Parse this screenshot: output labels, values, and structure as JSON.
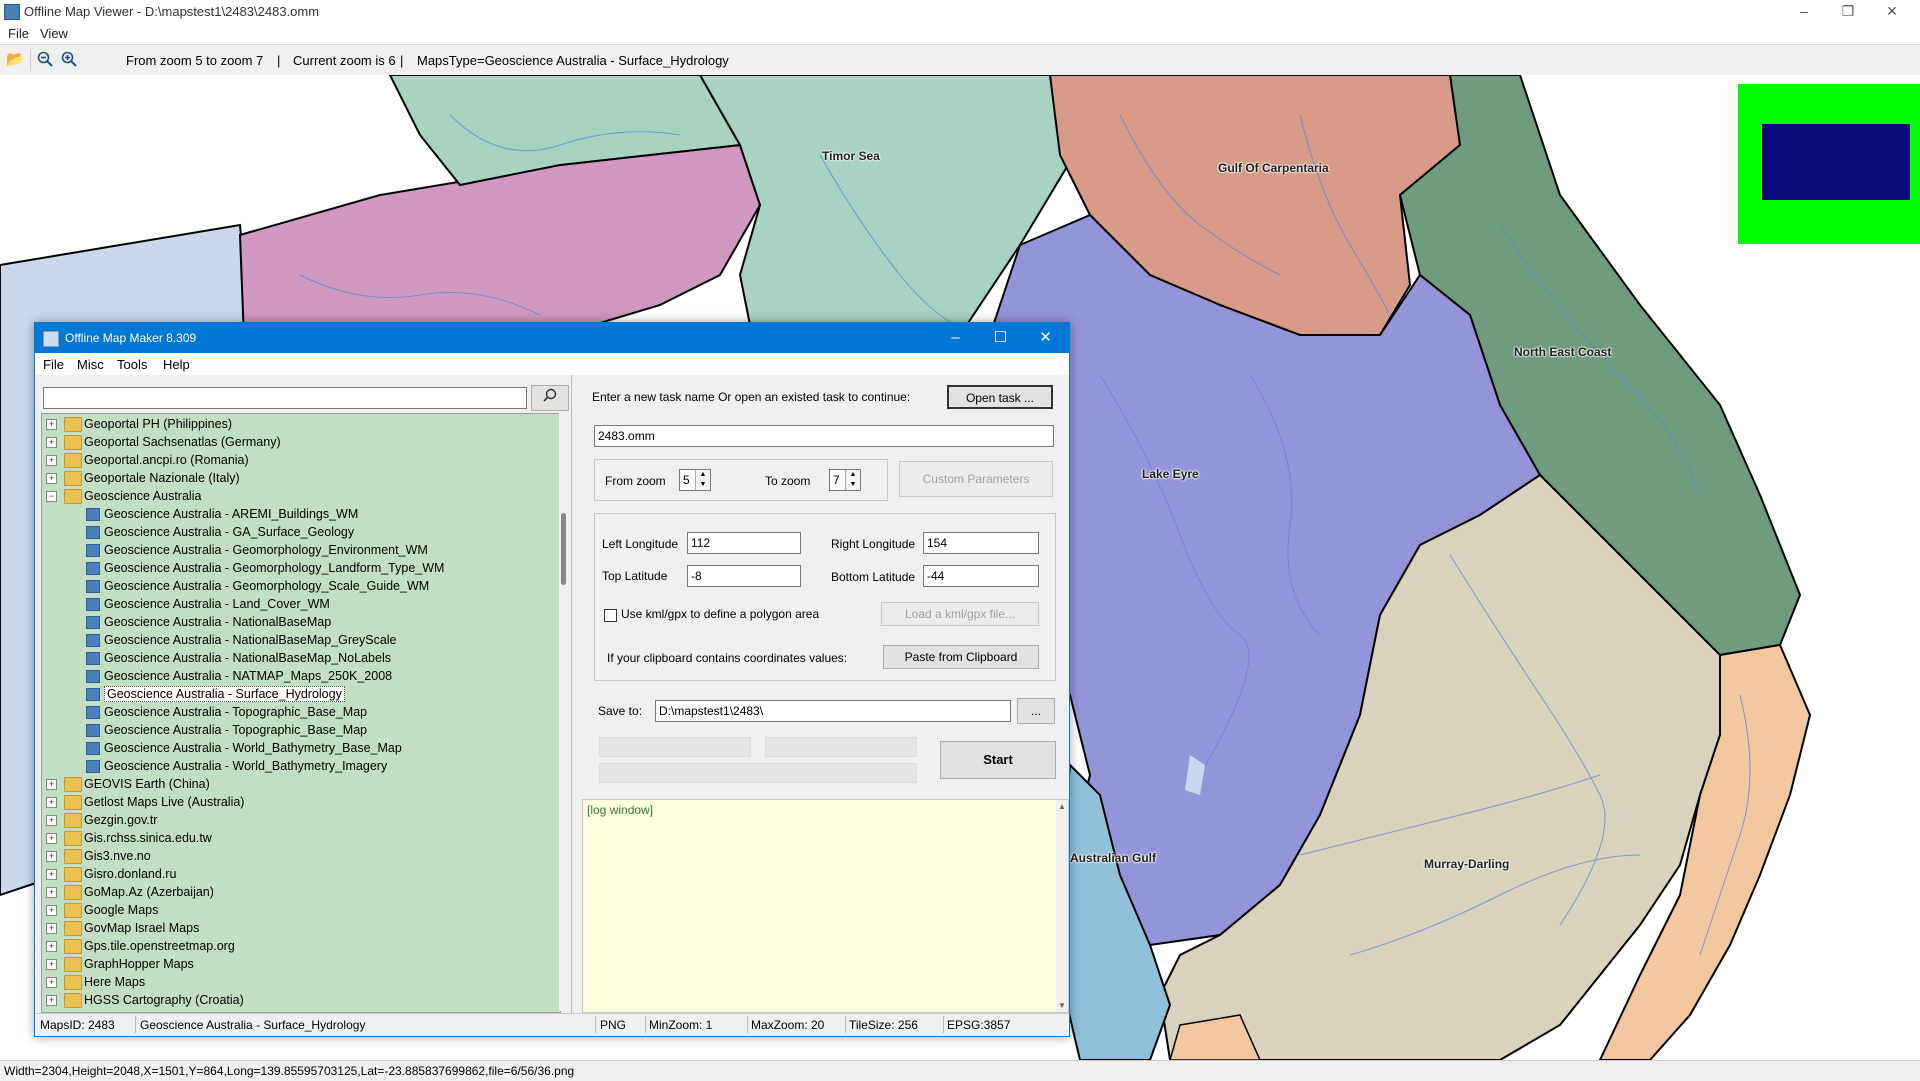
{
  "viewer": {
    "title": "Offline Map Viewer - D:\\mapstest1\\2483\\2483.omm",
    "menu": [
      "File",
      "View"
    ],
    "toolbar": {
      "zoom_range": "From zoom 5 to zoom 7",
      "separator1": "|",
      "current_zoom": "Current zoom is 6",
      "separator2": "|",
      "maps_type": "MapsType=Geoscience Australia - Surface_Hydrology"
    },
    "status": "Width=2304,Height=2048,X=1501,Y=864,Long=139.85595703125,Lat=-23.885837699862,file=6/56/36.png",
    "map_labels": {
      "timor_sea": "Timor Sea",
      "gulf_of_carpentaria": "Gulf Of Carpentaria",
      "north_east_coast": "North East Coast",
      "lake_eyre": "Lake Eyre",
      "australian_gulf": "Australian Gulf",
      "murray_darling": "Murray-Darling"
    }
  },
  "dialog": {
    "title": "Offline Map Maker 8.309",
    "menu": [
      "File",
      "Misc",
      "Tools",
      "Help"
    ],
    "search": {
      "value": "",
      "placeholder": ""
    },
    "tree": [
      {
        "label": "Geoportal PH (Philippines)",
        "level": 0,
        "expanded": false
      },
      {
        "label": "Geoportal Sachsenatlas (Germany)",
        "level": 0,
        "expanded": false
      },
      {
        "label": "Geoportal.ancpi.ro (Romania)",
        "level": 0,
        "expanded": false
      },
      {
        "label": "Geoportale Nazionale (Italy)",
        "level": 0,
        "expanded": false
      },
      {
        "label": "Geoscience Australia",
        "level": 0,
        "expanded": true
      },
      {
        "label": "Geoscience Australia - AREMI_Buildings_WM",
        "level": 1
      },
      {
        "label": "Geoscience Australia - GA_Surface_Geology",
        "level": 1
      },
      {
        "label": "Geoscience Australia - Geomorphology_Environment_WM",
        "level": 1
      },
      {
        "label": "Geoscience Australia - Geomorphology_Landform_Type_WM",
        "level": 1
      },
      {
        "label": "Geoscience Australia - Geomorphology_Scale_Guide_WM",
        "level": 1
      },
      {
        "label": "Geoscience Australia - Land_Cover_WM",
        "level": 1
      },
      {
        "label": "Geoscience Australia - NationalBaseMap",
        "level": 1
      },
      {
        "label": "Geoscience Australia - NationalBaseMap_GreyScale",
        "level": 1
      },
      {
        "label": "Geoscience Australia - NationalBaseMap_NoLabels",
        "level": 1
      },
      {
        "label": "Geoscience Australia - NATMAP_Maps_250K_2008",
        "level": 1
      },
      {
        "label": "Geoscience Australia - Surface_Hydrology",
        "level": 1,
        "selected": true
      },
      {
        "label": "Geoscience Australia - Topographic_Base_Map",
        "level": 1
      },
      {
        "label": "Geoscience Australia - Topographic_Base_Map",
        "level": 1
      },
      {
        "label": "Geoscience Australia - World_Bathymetry_Base_Map",
        "level": 1
      },
      {
        "label": "Geoscience Australia - World_Bathymetry_Imagery",
        "level": 1
      },
      {
        "label": "GEOVIS Earth (China)",
        "level": 0,
        "expanded": false
      },
      {
        "label": "Getlost Maps Live (Australia)",
        "level": 0,
        "expanded": false
      },
      {
        "label": "Gezgin.gov.tr",
        "level": 0,
        "expanded": false
      },
      {
        "label": "Gis.rchss.sinica.edu.tw",
        "level": 0,
        "expanded": false
      },
      {
        "label": "Gis3.nve.no",
        "level": 0,
        "expanded": false
      },
      {
        "label": "Gisro.donland.ru",
        "level": 0,
        "expanded": false
      },
      {
        "label": "GoMap.Az (Azerbaijan)",
        "level": 0,
        "expanded": false
      },
      {
        "label": "Google Maps",
        "level": 0,
        "expanded": false
      },
      {
        "label": "GovMap Israel Maps",
        "level": 0,
        "expanded": false
      },
      {
        "label": "Gps.tile.openstreetmap.org",
        "level": 0,
        "expanded": false
      },
      {
        "label": "GraphHopper Maps",
        "level": 0,
        "expanded": false
      },
      {
        "label": "Here Maps",
        "level": 0,
        "expanded": false
      },
      {
        "label": "HGSS Cartography (Croatia)",
        "level": 0,
        "expanded": false
      }
    ],
    "task": {
      "prompt": "Enter a new task name Or open an existed task to continue:",
      "open_button": "Open task ...",
      "name": "2483.omm"
    },
    "zoom": {
      "from_label": "From zoom",
      "from_value": "5",
      "to_label": "To zoom",
      "to_value": "7",
      "custom_button": "Custom Parameters"
    },
    "coords": {
      "left_label": "Left Longitude",
      "left_value": "112",
      "right_label": "Right Longitude",
      "right_value": "154",
      "top_label": "Top Latitude",
      "top_value": "-8",
      "bottom_label": "Bottom Latitude",
      "bottom_value": "-44",
      "kml_checkbox": "Use kml/gpx to define a polygon area",
      "kml_checked": false,
      "load_kml_button": "Load a kml/gpx file...",
      "clipboard_label": "If your clipboard contains coordinates values:",
      "paste_button": "Paste from Clipboard"
    },
    "save": {
      "label": "Save to:",
      "path": "D:\\mapstest1\\2483\\",
      "browse_button": "...",
      "start_button": "Start"
    },
    "log": "[log window]",
    "statusbar": {
      "maps_id": "MapsID: 2483",
      "maps_name": "Geoscience Australia - Surface_Hydrology",
      "format": "PNG",
      "min_zoom": "MinZoom: 1",
      "max_zoom": "MaxZoom: 20",
      "tile_size": "TileSize: 256",
      "epsg": "EPSG:3857"
    }
  },
  "colors": {
    "title_blue": "#0078d4",
    "tree_bg": "#c3dfc3",
    "log_bg": "#ffffe0",
    "minimap_green": "#00ff00",
    "minimap_view": "#0a0a78"
  }
}
